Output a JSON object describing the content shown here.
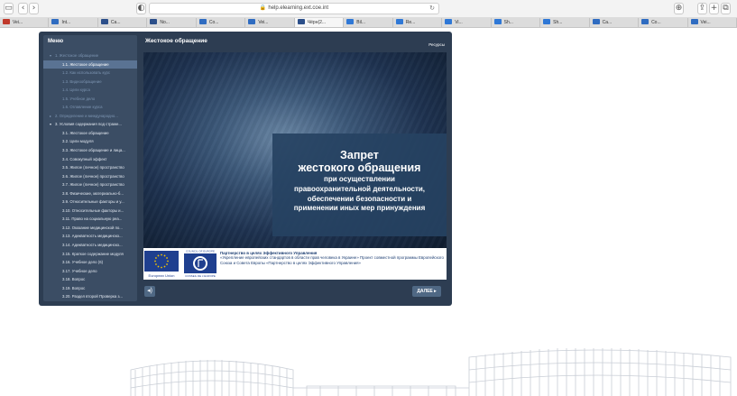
{
  "browser": {
    "address": "help.elearning.ext.coe.int",
    "tabs": [
      {
        "label": "Vei...",
        "color": "#c0392b"
      },
      {
        "label": "Int...",
        "color": "#2f6cc1"
      },
      {
        "label": "Ca...",
        "color": "#2c4f8a"
      },
      {
        "label": "No...",
        "color": "#2c4f8a"
      },
      {
        "label": "Co...",
        "color": "#2f6cc1"
      },
      {
        "label": "Vei...",
        "color": "#2f6cc1"
      },
      {
        "label": "Чёрн(2...",
        "color": "#2c4f8a",
        "active": true
      },
      {
        "label": "Bil...",
        "color": "#2f78d6"
      },
      {
        "label": "Re...",
        "color": "#2f78d6"
      },
      {
        "label": "Vi...",
        "color": "#2f78d6"
      },
      {
        "label": "Sh...",
        "color": "#2f78d6"
      },
      {
        "label": "Sh...",
        "color": "#2f78d6"
      },
      {
        "label": "Ca...",
        "color": "#2f6cc1"
      },
      {
        "label": "Co...",
        "color": "#2f6cc1"
      },
      {
        "label": "Vei...",
        "color": "#2f6cc1"
      }
    ]
  },
  "sidebar": {
    "title": "Меню",
    "items": [
      {
        "label": "1. Жестокое обращение",
        "arrow": "▾",
        "state": "dim",
        "indent": 0
      },
      {
        "label": "1.1. Жестокое обращение",
        "state": "sel",
        "indent": 1
      },
      {
        "label": "1.2. Как использовать курс",
        "state": "dim",
        "indent": 1
      },
      {
        "label": "1.3. Видеообращение",
        "state": "dim",
        "indent": 1
      },
      {
        "label": "1.4. Цели курса",
        "state": "dim",
        "indent": 1
      },
      {
        "label": "1.5. Учебное дело",
        "state": "dim",
        "indent": 1
      },
      {
        "label": "1.6. Оглавление курса",
        "state": "dim",
        "indent": 1
      },
      {
        "label": "2. Определение и международно...",
        "arrow": "▸",
        "state": "dim",
        "indent": 0
      },
      {
        "label": "3. Условия содержания под страже...",
        "arrow": "▾",
        "state": "",
        "indent": 0
      },
      {
        "label": "3.1. Жестокое обращение",
        "state": "",
        "indent": 1
      },
      {
        "label": "3.2. Цели модуля",
        "state": "",
        "indent": 1
      },
      {
        "label": "3.3. Жестокое обращение и лица...",
        "state": "",
        "indent": 1
      },
      {
        "label": "3.4. Совокупный эффект",
        "state": "",
        "indent": 1
      },
      {
        "label": "3.5. Жилое (личное) пространство",
        "state": "",
        "indent": 1
      },
      {
        "label": "3.6. Жилое (личное) пространство",
        "state": "",
        "indent": 1
      },
      {
        "label": "3.7. Жилое (личное) пространство",
        "state": "",
        "indent": 1
      },
      {
        "label": "3.8. Физические, материально-б...",
        "state": "",
        "indent": 1
      },
      {
        "label": "3.9. Относительные факторы и у...",
        "state": "",
        "indent": 1
      },
      {
        "label": "3.10. Относительные факторы и...",
        "state": "",
        "indent": 1
      },
      {
        "label": "3.11. Право на социальную реа...",
        "state": "",
        "indent": 1
      },
      {
        "label": "3.12. Оказание медицинской по...",
        "state": "",
        "indent": 1
      },
      {
        "label": "3.13. Адекватность медицинско...",
        "state": "",
        "indent": 1
      },
      {
        "label": "3.14. Адекватность медицинско...",
        "state": "",
        "indent": 1
      },
      {
        "label": "3.15. Краткое содержание модуля",
        "state": "",
        "indent": 1
      },
      {
        "label": "3.16. Учебное дело (6)",
        "state": "",
        "indent": 1
      },
      {
        "label": "3.17. Учебное дело",
        "state": "",
        "indent": 1
      },
      {
        "label": "3.18. Вопрос",
        "state": "",
        "indent": 1
      },
      {
        "label": "3.19. Вопрос",
        "state": "",
        "indent": 1
      },
      {
        "label": "3.20. Раздел второй Проверка з...",
        "state": "",
        "indent": 1
      },
      {
        "label": "3.21. Проверка знаний",
        "state": "",
        "indent": 1
      }
    ]
  },
  "slide": {
    "title": "Жестокое обращение",
    "resources": "Ресурсы",
    "line1": "Запрет",
    "line2": "жестокого обращения",
    "line3": "при осуществлении",
    "line4": "правоохранительной деятельности,",
    "line5": "обеспечении безопасности и",
    "line6": "применении иных мер принуждения"
  },
  "footer": {
    "eu_caption": "European Union",
    "coe_top": "COUNCIL OF EUROPE",
    "coe_bottom": "CONSEIL DE L'EUROPE",
    "partner_title": "Партнерство в целях Эффективного Управления",
    "partner_text": "«Укрепление европейских стандартов в области прав человека в Украине» Проект совместной программы Европейского Союза и Совета Европы «Партнерство в целях Эффективного Управления»"
  },
  "controls": {
    "next_label": "ДАЛЕЕ ▸"
  },
  "colors": {
    "player_bg": "#2d3d52",
    "sidebar_bg": "#3b4d64",
    "selected_item": "#5a7393",
    "eu_blue": "#1f3f8f",
    "eu_star": "#f3c400"
  }
}
